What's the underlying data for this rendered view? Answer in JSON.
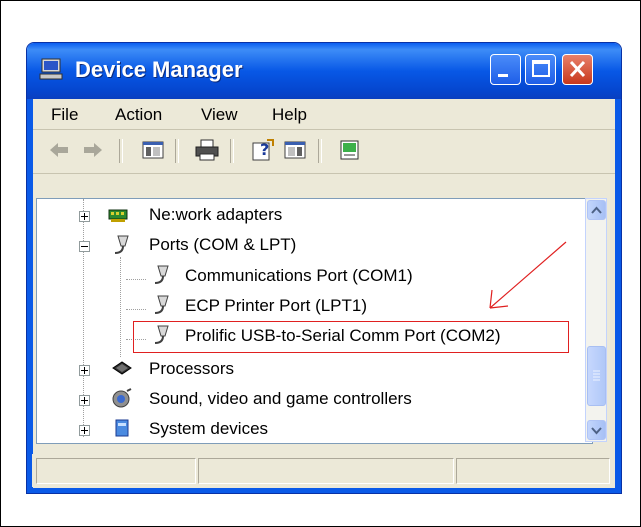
{
  "window": {
    "title": "Device Manager"
  },
  "menu": {
    "file": "File",
    "action": "Action",
    "view": "View",
    "help": "Help"
  },
  "tree": {
    "network": "Ne:work adapters",
    "ports": "Ports (COM & LPT)",
    "com1": "Communications Port (COM1)",
    "lpt1": "ECP Printer Port (LPT1)",
    "com2": "Prolific USB-to-Serial Comm Port (COM2)",
    "processors": "Processors",
    "sound": "Sound, video and game controllers",
    "system": "System devices"
  },
  "colors": {
    "highlight": "#e02020",
    "titlebar": "#0858e6"
  },
  "icons": [
    "computer-icon",
    "back-icon",
    "forward-icon",
    "show-hide-tree-icon",
    "print-icon",
    "properties-help-icon",
    "pane-icon",
    "scan-hardware-icon",
    "network-icon",
    "port-icon",
    "processor-icon",
    "sound-icon",
    "system-icon"
  ]
}
